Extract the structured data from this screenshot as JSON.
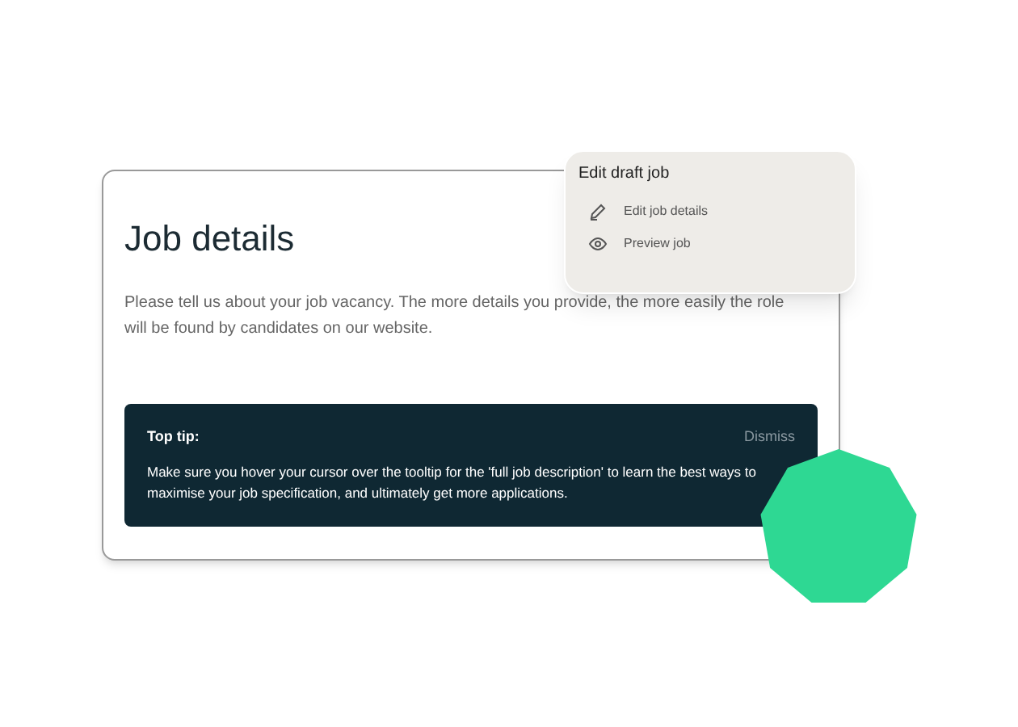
{
  "card": {
    "title": "Job details",
    "description": "Please tell us about your job vacancy. The more details you provide, the more easily the role will be found by candidates on our website."
  },
  "tip": {
    "title": "Top tip:",
    "dismiss": "Dismiss",
    "text": "Make sure you hover your cursor over the tooltip for the 'full job description' to learn the best ways to maximise your job specification, and ultimately get more applications."
  },
  "menu": {
    "title": "Edit draft job",
    "items": [
      {
        "kind": "edit",
        "label": "Edit job details"
      },
      {
        "kind": "preview",
        "label": "Preview job"
      }
    ]
  }
}
